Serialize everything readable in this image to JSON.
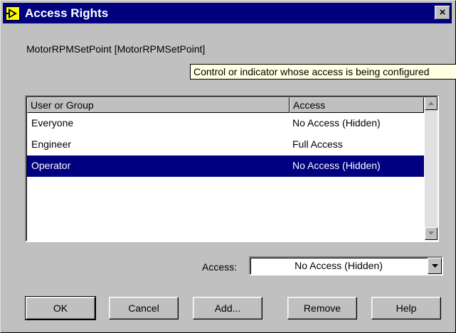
{
  "window": {
    "title": "Access Rights",
    "close_symbol": "×"
  },
  "control_name": "MotorRPMSetPoint [MotorRPMSetPoint]",
  "tooltip": "Control or indicator whose access is being configured",
  "list": {
    "columns": [
      "User or Group",
      "Access"
    ],
    "rows": [
      {
        "user": "Everyone",
        "access": "No Access (Hidden)",
        "selected": false
      },
      {
        "user": "Engineer",
        "access": "Full Access",
        "selected": false
      },
      {
        "user": "Operator",
        "access": "No Access (Hidden)",
        "selected": true
      }
    ]
  },
  "access_field": {
    "label": "Access:",
    "value": "No Access (Hidden)"
  },
  "buttons": {
    "ok": "OK",
    "cancel": "Cancel",
    "add": "Add...",
    "remove": "Remove",
    "help": "Help"
  },
  "icons": {
    "title": "labview-vi-icon",
    "close": "close-icon",
    "scroll_up": "arrow-up-icon",
    "scroll_down": "arrow-down-icon",
    "dropdown": "chevron-down-icon"
  },
  "colors": {
    "titlebar": "#000080",
    "selection": "#000080",
    "tooltip_bg": "#ffffe1",
    "dialog_bg": "#c0c0c0"
  }
}
